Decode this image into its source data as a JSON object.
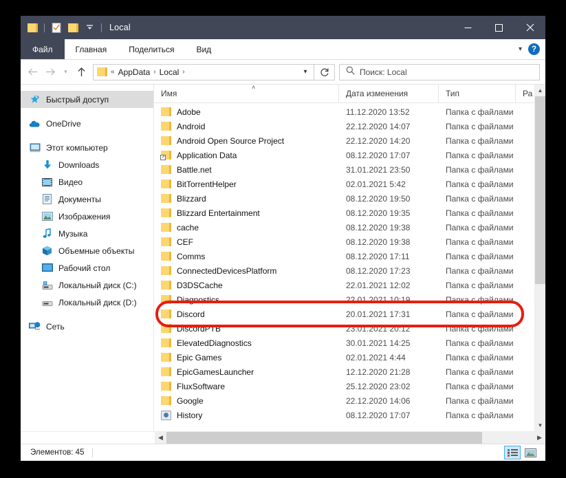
{
  "window": {
    "title": "Local",
    "quick_access_icons": [
      "folder-icon",
      "properties-icon",
      "new-folder-icon",
      "chevron-down-icon"
    ],
    "controls": {
      "minimize": "—",
      "maximize": "☐",
      "close": "✕"
    }
  },
  "ribbon": {
    "file_tab": "Файл",
    "tabs": [
      {
        "label": "Главная"
      },
      {
        "label": "Поделиться"
      },
      {
        "label": "Вид"
      }
    ],
    "collapse_icon": "chevron-down-icon",
    "help_label": "?"
  },
  "address": {
    "back_icon": "arrow-left-icon",
    "forward_icon": "arrow-right-icon",
    "recent_icon": "chevron-down-icon",
    "up_icon": "arrow-up-icon",
    "folder_icon": "folder-icon",
    "root_chevron": "«",
    "crumbs": [
      "AppData",
      "Local"
    ],
    "separator": "›",
    "dropdown_icon": "chevron-down-icon",
    "refresh_icon": "refresh-icon"
  },
  "search": {
    "icon": "search-icon",
    "placeholder": "Поиск: Local"
  },
  "nav_pane": {
    "items": [
      {
        "label": "Быстрый доступ",
        "icon": "pin-star-icon",
        "selected": true,
        "indent": false
      },
      {
        "label": "OneDrive",
        "icon": "cloud-icon",
        "selected": false,
        "indent": false
      },
      {
        "label": "Этот компьютер",
        "icon": "computer-icon",
        "selected": false,
        "indent": false
      },
      {
        "label": "Downloads",
        "icon": "download-arrow-icon",
        "selected": false,
        "indent": true
      },
      {
        "label": "Видео",
        "icon": "video-icon",
        "selected": false,
        "indent": true
      },
      {
        "label": "Документы",
        "icon": "documents-icon",
        "selected": false,
        "indent": true
      },
      {
        "label": "Изображения",
        "icon": "pictures-icon",
        "selected": false,
        "indent": true
      },
      {
        "label": "Музыка",
        "icon": "music-note-icon",
        "selected": false,
        "indent": true
      },
      {
        "label": "Объемные объекты",
        "icon": "3d-objects-icon",
        "selected": false,
        "indent": true
      },
      {
        "label": "Рабочий стол",
        "icon": "desktop-icon",
        "selected": false,
        "indent": true
      },
      {
        "label": "Локальный диск (C:)",
        "icon": "system-drive-icon",
        "selected": false,
        "indent": true
      },
      {
        "label": "Локальный диск (D:)",
        "icon": "drive-icon",
        "selected": false,
        "indent": true
      },
      {
        "label": "Сеть",
        "icon": "network-icon",
        "selected": false,
        "indent": false
      }
    ]
  },
  "file_list": {
    "columns": [
      {
        "label": "Имя",
        "sorted": true
      },
      {
        "label": "Дата изменения",
        "sorted": false
      },
      {
        "label": "Тип",
        "sorted": false
      },
      {
        "label": "Ра",
        "sorted": false
      }
    ],
    "sort_caret": "˄",
    "rows": [
      {
        "name": "Adobe",
        "date": "11.12.2020 13:52",
        "type": "Папка с файлами",
        "icon": "folder-icon",
        "highlighted": false
      },
      {
        "name": "Android",
        "date": "22.12.2020 14:07",
        "type": "Папка с файлами",
        "icon": "folder-icon",
        "highlighted": false
      },
      {
        "name": "Android Open Source Project",
        "date": "22.12.2020 14:20",
        "type": "Папка с файлами",
        "icon": "folder-icon",
        "highlighted": false
      },
      {
        "name": "Application Data",
        "date": "08.12.2020 17:07",
        "type": "Папка с файлами",
        "icon": "folder-shortcut-icon",
        "highlighted": false
      },
      {
        "name": "Battle.net",
        "date": "31.01.2021 23:50",
        "type": "Папка с файлами",
        "icon": "folder-icon",
        "highlighted": false
      },
      {
        "name": "BitTorrentHelper",
        "date": "02.01.2021 5:42",
        "type": "Папка с файлами",
        "icon": "folder-icon",
        "highlighted": false
      },
      {
        "name": "Blizzard",
        "date": "08.12.2020 19:50",
        "type": "Папка с файлами",
        "icon": "folder-icon",
        "highlighted": false
      },
      {
        "name": "Blizzard Entertainment",
        "date": "08.12.2020 19:35",
        "type": "Папка с файлами",
        "icon": "folder-icon",
        "highlighted": false
      },
      {
        "name": "cache",
        "date": "08.12.2020 19:38",
        "type": "Папка с файлами",
        "icon": "folder-icon",
        "highlighted": false
      },
      {
        "name": "CEF",
        "date": "08.12.2020 19:38",
        "type": "Папка с файлами",
        "icon": "folder-icon",
        "highlighted": false
      },
      {
        "name": "Comms",
        "date": "08.12.2020 17:11",
        "type": "Папка с файлами",
        "icon": "folder-icon",
        "highlighted": false
      },
      {
        "name": "ConnectedDevicesPlatform",
        "date": "08.12.2020 17:23",
        "type": "Папка с файлами",
        "icon": "folder-icon",
        "highlighted": false
      },
      {
        "name": "D3DSCache",
        "date": "22.01.2021 12:02",
        "type": "Папка с файлами",
        "icon": "folder-icon",
        "highlighted": false
      },
      {
        "name": "Diagnostics",
        "date": "22.01.2021 10:19",
        "type": "Папка с файлами",
        "icon": "folder-icon",
        "highlighted": false
      },
      {
        "name": "Discord",
        "date": "20.01.2021 17:31",
        "type": "Папка с файлами",
        "icon": "folder-icon",
        "highlighted": true
      },
      {
        "name": "DiscordPTB",
        "date": "23.01.2021 20:12",
        "type": "Папка с файлами",
        "icon": "folder-icon",
        "highlighted": false
      },
      {
        "name": "ElevatedDiagnostics",
        "date": "30.01.2021 14:25",
        "type": "Папка с файлами",
        "icon": "folder-icon",
        "highlighted": false
      },
      {
        "name": "Epic Games",
        "date": "02.01.2021 4:44",
        "type": "Папка с файлами",
        "icon": "folder-icon",
        "highlighted": false
      },
      {
        "name": "EpicGamesLauncher",
        "date": "12.12.2020 21:28",
        "type": "Папка с файлами",
        "icon": "folder-icon",
        "highlighted": false
      },
      {
        "name": "FluxSoftware",
        "date": "25.12.2020 23:02",
        "type": "Папка с файлами",
        "icon": "folder-icon",
        "highlighted": false
      },
      {
        "name": "Google",
        "date": "22.12.2020 14:06",
        "type": "Папка с файлами",
        "icon": "folder-icon",
        "highlighted": false
      },
      {
        "name": "History",
        "date": "08.12.2020 17:07",
        "type": "Папка с файлами",
        "icon": "history-icon",
        "highlighted": false
      }
    ]
  },
  "scrollbars": {
    "vertical_up_icon": "chevron-up-icon",
    "vertical_down_icon": "chevron-down-icon",
    "horizontal_left_icon": "chevron-left-icon",
    "horizontal_right_icon": "chevron-right-icon"
  },
  "status_bar": {
    "items_text": "Элементов: 45",
    "view_details_icon": "details-view-icon",
    "view_thumbnails_icon": "large-icons-view-icon"
  },
  "colors": {
    "titlebar": "#414757",
    "accent": "#0f6cbd",
    "annotation_red": "#e81d0e",
    "folder_yellow": "#fcd670",
    "selection_gray": "#dcdcdc"
  }
}
